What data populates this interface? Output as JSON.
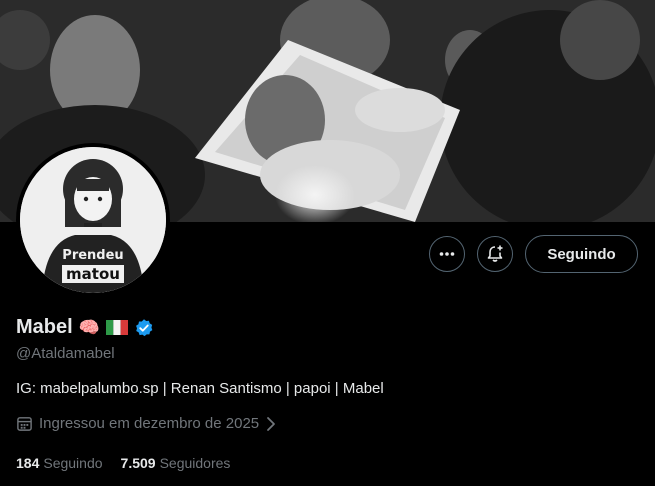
{
  "profile": {
    "display_name": "Mabel",
    "emoji_brain": "🧠",
    "handle": "@Ataldamabel",
    "bio": "IG: mabelpalumbo.sp | Renan Santismo | papoi | Mabel",
    "joined": "Ingressou em dezembro de 2025",
    "verified": true
  },
  "avatar": {
    "shirt_text_line1": "Prendeu",
    "shirt_text_line2": "matou"
  },
  "actions": {
    "more_icon": "ellipsis-icon",
    "bell_icon": "bell-plus-icon",
    "following_label": "Seguindo"
  },
  "stats": {
    "following_count": "184",
    "following_label": "Seguindo",
    "followers_count": "7.509",
    "followers_label": "Seguidores"
  },
  "colors": {
    "background": "#000000",
    "text_primary": "#e7e9ea",
    "text_secondary": "#71767b",
    "border": "#536471",
    "verified_blue": "#1d9bf0"
  }
}
